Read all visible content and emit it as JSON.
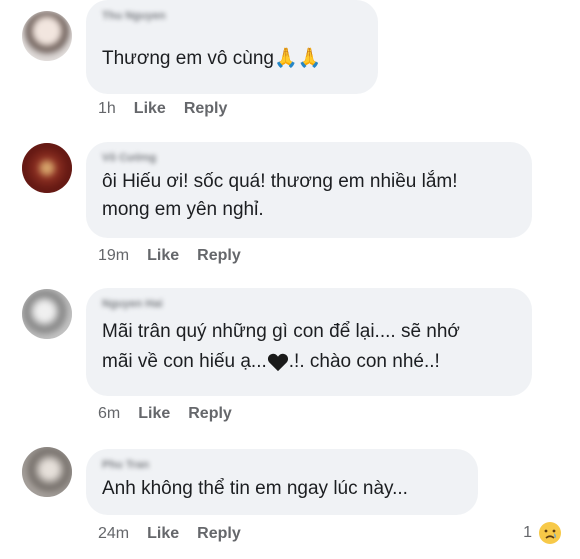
{
  "comments": [
    {
      "author": "Thu Nguyen",
      "text_lines": [
        "Thương em vô cùng"
      ],
      "emoji": "🙏🙏",
      "time": "1h",
      "like": "Like",
      "reply": "Reply"
    },
    {
      "author": "Võ Cường",
      "text_lines": [
        "ôi Hiếu ơi! sốc quá! thương em nhiều lắm!",
        "mong em yên nghỉ."
      ],
      "time": "19m",
      "like": "Like",
      "reply": "Reply"
    },
    {
      "author": "Nguyen Hai",
      "text_lines": [
        "Mãi trân quý những gì con để lại.... sẽ nhớ",
        "mãi về con hiếu ạ...",
        ".!. chào con nhé..!"
      ],
      "time": "6m",
      "like": "Like",
      "reply": "Reply"
    },
    {
      "author": "Phu Tran",
      "text_lines": [
        "Anh không thể tin em ngay lúc này..."
      ],
      "time": "24m",
      "like": "Like",
      "reply": "Reply"
    }
  ],
  "reaction": {
    "count": "1",
    "icon": "crying-face-icon"
  },
  "colors": {
    "bubble": "#f0f2f5",
    "meta": "#65676b",
    "text": "#1c1e21"
  }
}
